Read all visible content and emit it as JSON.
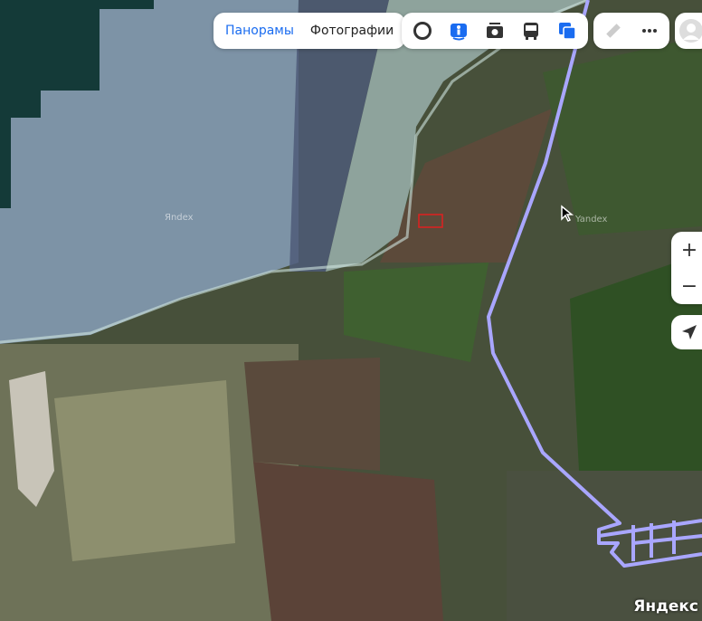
{
  "tabs": {
    "panoramas": "Панорамы",
    "photos": "Фотографии"
  },
  "layers": [
    "circle-layer-icon",
    "panorama-person-icon",
    "camera-icon",
    "bus-icon",
    "layers-icon"
  ],
  "tools": [
    "ruler-icon",
    "more-icon"
  ],
  "zoom": {
    "in": "+",
    "out": "−"
  },
  "watermarks": [
    "Яndex",
    "Yandex"
  ],
  "logo": "Яндекс",
  "colors": {
    "accent": "#1a6cf0",
    "route": "#a9a6ff"
  }
}
